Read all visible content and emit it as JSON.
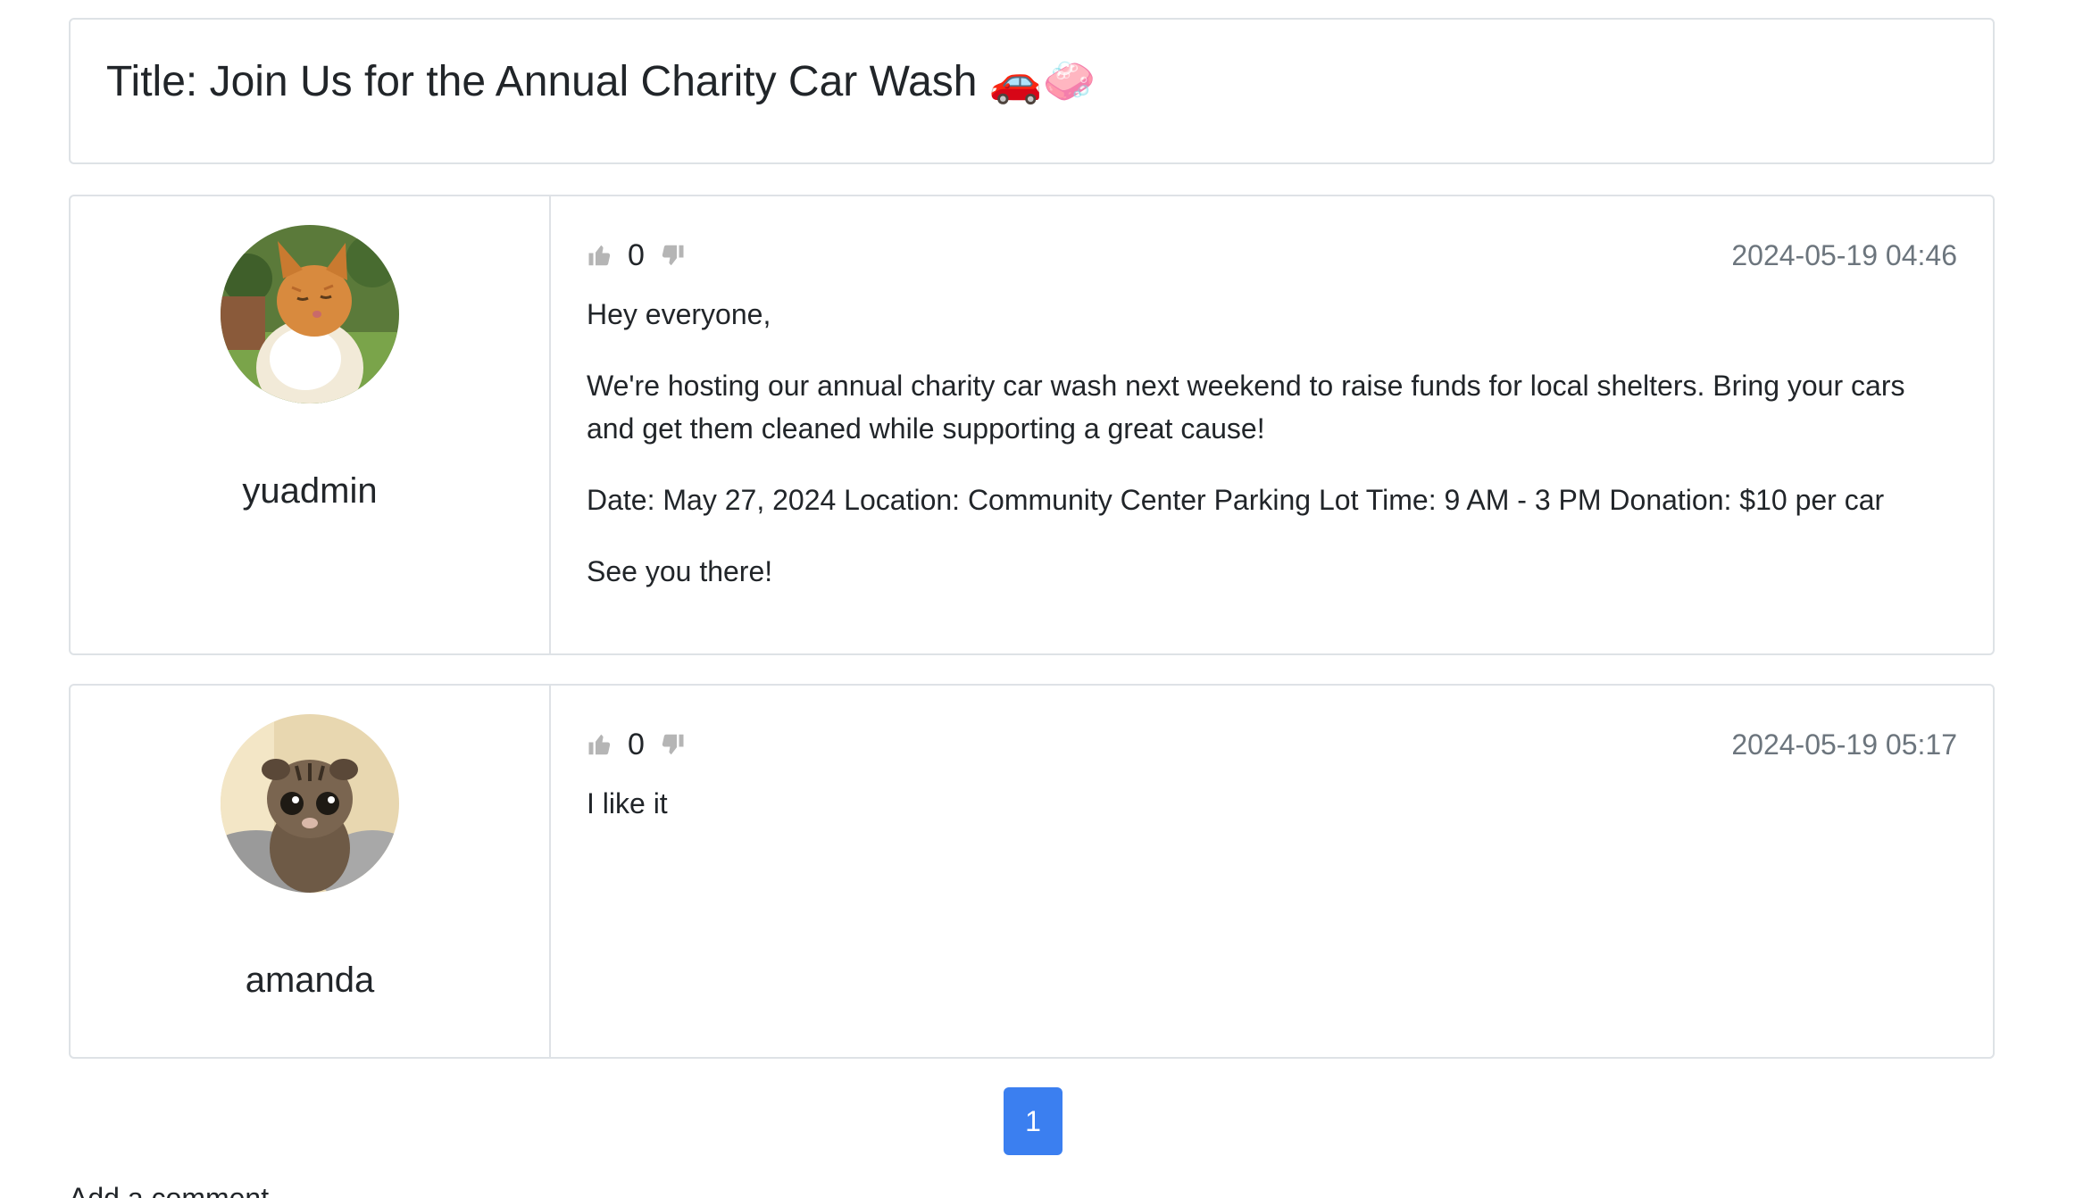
{
  "thread": {
    "title": "Title: Join Us for the Annual Charity Car Wash 🚗🧼"
  },
  "posts": [
    {
      "author": "yuadmin",
      "avatar": "orange-tabby-cat-avatar",
      "votes": "0",
      "timestamp": "2024-05-19 04:46",
      "paragraphs": [
        "Hey everyone,",
        "We're hosting our annual charity car wash next weekend to raise funds for local shelters. Bring your cars and get them cleaned while supporting a great cause!",
        "Date: May 27, 2024 Location: Community Center Parking Lot Time: 9 AM - 3 PM Donation: $10 per car",
        "See you there!"
      ]
    },
    {
      "author": "amanda",
      "avatar": "tabby-kitten-avatar",
      "votes": "0",
      "timestamp": "2024-05-19 05:17",
      "paragraphs": [
        "I like it"
      ]
    }
  ],
  "pagination": {
    "current_page": "1"
  },
  "add_comment": {
    "label": "Add a comment"
  },
  "icons": {
    "upvote": "thumbs-up-icon",
    "downvote": "thumbs-down-icon"
  },
  "colors": {
    "accent": "#3b7ff0",
    "border": "#dee2e6",
    "muted_text": "#6c757d",
    "vote_icon": "#b5b5b5"
  }
}
